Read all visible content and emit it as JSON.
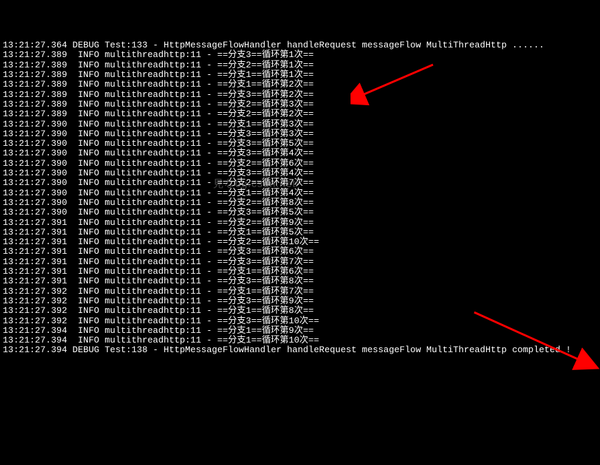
{
  "watermark": "見なog.csdn.net/",
  "log_lines": [
    {
      "ts": "13:21:27.364",
      "lvl": "DEBUG",
      "src": "Test:133",
      "msg": "HttpMessageFlowHandler handleRequest messageFlow MultiThreadHttp ......"
    },
    {
      "ts": "13:21:27.389",
      "lvl": "INFO",
      "src": "multithreadhttp:11",
      "msg": "==分支3==循环第1次=="
    },
    {
      "ts": "13:21:27.389",
      "lvl": "INFO",
      "src": "multithreadhttp:11",
      "msg": "==分支2==循环第1次=="
    },
    {
      "ts": "13:21:27.389",
      "lvl": "INFO",
      "src": "multithreadhttp:11",
      "msg": "==分支1==循环第1次=="
    },
    {
      "ts": "13:21:27.389",
      "lvl": "INFO",
      "src": "multithreadhttp:11",
      "msg": "==分支1==循环第2次=="
    },
    {
      "ts": "13:21:27.389",
      "lvl": "INFO",
      "src": "multithreadhttp:11",
      "msg": "==分支3==循环第2次=="
    },
    {
      "ts": "13:21:27.389",
      "lvl": "INFO",
      "src": "multithreadhttp:11",
      "msg": "==分支2==循环第3次=="
    },
    {
      "ts": "13:21:27.389",
      "lvl": "INFO",
      "src": "multithreadhttp:11",
      "msg": "==分支2==循环第2次=="
    },
    {
      "ts": "13:21:27.390",
      "lvl": "INFO",
      "src": "multithreadhttp:11",
      "msg": "==分支1==循环第3次=="
    },
    {
      "ts": "13:21:27.390",
      "lvl": "INFO",
      "src": "multithreadhttp:11",
      "msg": "==分支3==循环第3次=="
    },
    {
      "ts": "13:21:27.390",
      "lvl": "INFO",
      "src": "multithreadhttp:11",
      "msg": "==分支3==循环第5次=="
    },
    {
      "ts": "13:21:27.390",
      "lvl": "INFO",
      "src": "multithreadhttp:11",
      "msg": "==分支3==循环第4次=="
    },
    {
      "ts": "13:21:27.390",
      "lvl": "INFO",
      "src": "multithreadhttp:11",
      "msg": "==分支2==循环第6次=="
    },
    {
      "ts": "13:21:27.390",
      "lvl": "INFO",
      "src": "multithreadhttp:11",
      "msg": "==分支3==循环第4次=="
    },
    {
      "ts": "13:21:27.390",
      "lvl": "INFO",
      "src": "multithreadhttp:11",
      "msg": "==分支2==循环第7次=="
    },
    {
      "ts": "13:21:27.390",
      "lvl": "INFO",
      "src": "multithreadhttp:11",
      "msg": "==分支1==循环第4次=="
    },
    {
      "ts": "13:21:27.390",
      "lvl": "INFO",
      "src": "multithreadhttp:11",
      "msg": "==分支2==循环第8次=="
    },
    {
      "ts": "13:21:27.390",
      "lvl": "INFO",
      "src": "multithreadhttp:11",
      "msg": "==分支3==循环第5次=="
    },
    {
      "ts": "13:21:27.391",
      "lvl": "INFO",
      "src": "multithreadhttp:11",
      "msg": "==分支2==循环第9次=="
    },
    {
      "ts": "13:21:27.391",
      "lvl": "INFO",
      "src": "multithreadhttp:11",
      "msg": "==分支1==循环第5次=="
    },
    {
      "ts": "13:21:27.391",
      "lvl": "INFO",
      "src": "multithreadhttp:11",
      "msg": "==分支2==循环第10次=="
    },
    {
      "ts": "13:21:27.391",
      "lvl": "INFO",
      "src": "multithreadhttp:11",
      "msg": "==分支3==循环第6次=="
    },
    {
      "ts": "13:21:27.391",
      "lvl": "INFO",
      "src": "multithreadhttp:11",
      "msg": "==分支3==循环第7次=="
    },
    {
      "ts": "13:21:27.391",
      "lvl": "INFO",
      "src": "multithreadhttp:11",
      "msg": "==分支1==循环第6次=="
    },
    {
      "ts": "13:21:27.391",
      "lvl": "INFO",
      "src": "multithreadhttp:11",
      "msg": "==分支3==循环第8次=="
    },
    {
      "ts": "13:21:27.392",
      "lvl": "INFO",
      "src": "multithreadhttp:11",
      "msg": "==分支1==循环第7次=="
    },
    {
      "ts": "13:21:27.392",
      "lvl": "INFO",
      "src": "multithreadhttp:11",
      "msg": "==分支3==循环第9次=="
    },
    {
      "ts": "13:21:27.392",
      "lvl": "INFO",
      "src": "multithreadhttp:11",
      "msg": "==分支1==循环第8次=="
    },
    {
      "ts": "13:21:27.392",
      "lvl": "INFO",
      "src": "multithreadhttp:11",
      "msg": "==分支3==循环第10次=="
    },
    {
      "ts": "13:21:27.394",
      "lvl": "INFO",
      "src": "multithreadhttp:11",
      "msg": "==分支1==循环第9次=="
    },
    {
      "ts": "13:21:27.394",
      "lvl": "INFO",
      "src": "multithreadhttp:11",
      "msg": "==分支1==循环第10次=="
    },
    {
      "ts": "13:21:27.394",
      "lvl": "DEBUG",
      "src": "Test:138",
      "msg": "HttpMessageFlowHandler handleRequest messageFlow MultiThreadHttp completed !"
    }
  ]
}
